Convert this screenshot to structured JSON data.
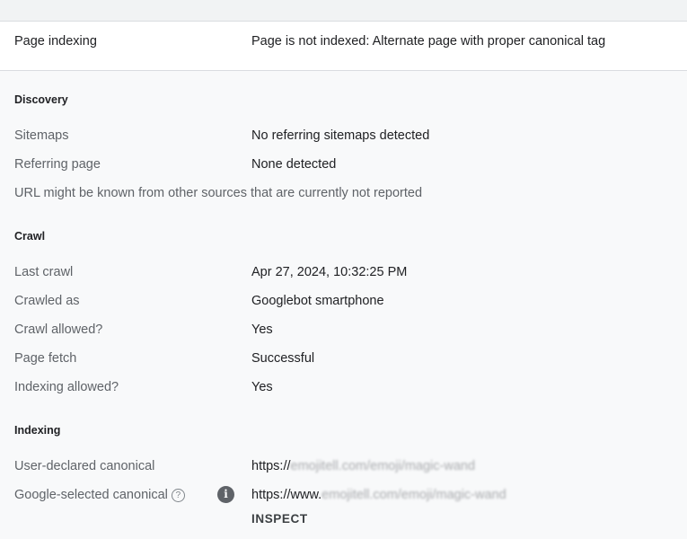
{
  "summary": {
    "label": "Page indexing",
    "value": "Page is not indexed: Alternate page with proper canonical tag"
  },
  "discovery": {
    "title": "Discovery",
    "sitemaps_label": "Sitemaps",
    "sitemaps_value": "No referring sitemaps detected",
    "referring_label": "Referring page",
    "referring_value": "None detected",
    "note": "URL might be known from other sources that are currently not reported"
  },
  "crawl": {
    "title": "Crawl",
    "last_crawl_label": "Last crawl",
    "last_crawl_value": "Apr 27, 2024, 10:32:25 PM",
    "crawled_as_label": "Crawled as",
    "crawled_as_value": "Googlebot smartphone",
    "crawl_allowed_label": "Crawl allowed?",
    "crawl_allowed_value": "Yes",
    "page_fetch_label": "Page fetch",
    "page_fetch_value": "Successful",
    "indexing_allowed_label": "Indexing allowed?",
    "indexing_allowed_value": "Yes"
  },
  "indexing": {
    "title": "Indexing",
    "user_canonical_label": "User-declared canonical",
    "user_canonical_prefix": "https://",
    "user_canonical_blurred": "emojitell.com/emoji/magic-wand",
    "google_canonical_label": "Google-selected canonical",
    "google_canonical_help": "?",
    "google_canonical_info": "i",
    "google_canonical_prefix": "https://www.",
    "google_canonical_blurred": "emojitell.com/emoji/magic-wand",
    "inspect_label": "INSPECT"
  },
  "icons": {
    "help": "help-circle-icon",
    "info": "info-icon"
  }
}
